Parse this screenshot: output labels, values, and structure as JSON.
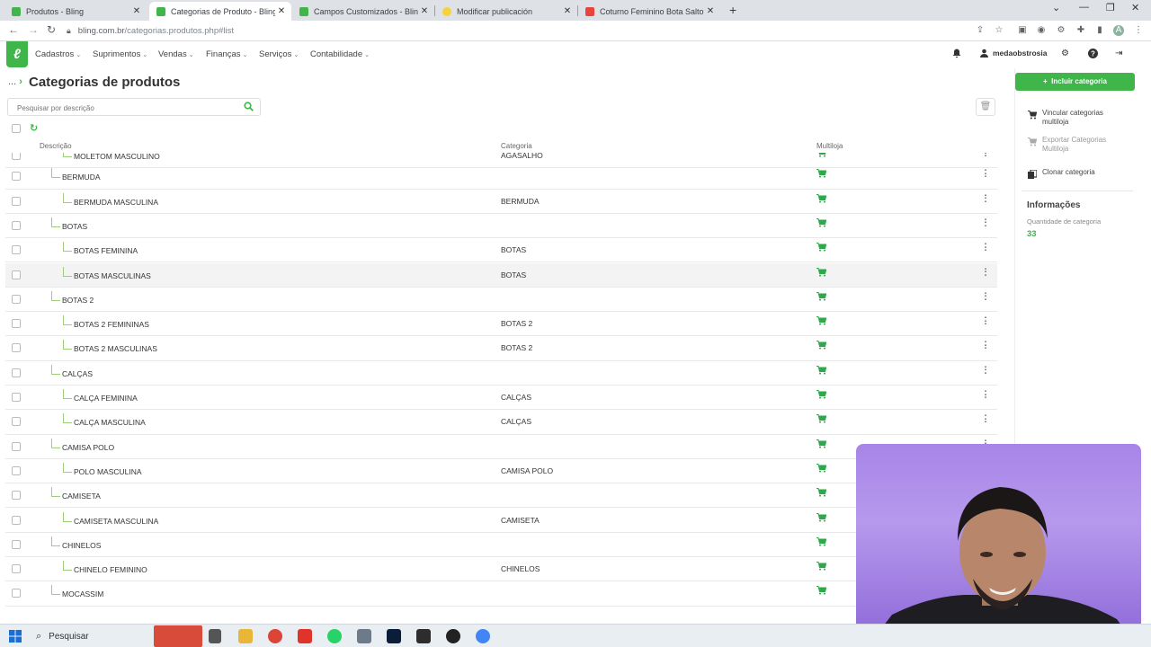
{
  "browser": {
    "tabs": [
      {
        "title": "Produtos - Bling",
        "active": false,
        "favicon": "bling-icon"
      },
      {
        "title": "Categorias de Produto - Bling",
        "active": true,
        "favicon": "bling-icon"
      },
      {
        "title": "Campos Customizados - Bling",
        "active": false,
        "favicon": "bling-icon"
      },
      {
        "title": "Modificar publicación",
        "active": false,
        "favicon": "mercadolivre-icon"
      },
      {
        "title": "Coturno Feminino Bota Salto Bai",
        "active": false,
        "favicon": "shop-icon"
      }
    ],
    "url_host": "bling.com.br",
    "url_path": "/categorias.produtos.php#list"
  },
  "app": {
    "menu": [
      {
        "label": "Cadastros"
      },
      {
        "label": "Suprimentos"
      },
      {
        "label": "Vendas"
      },
      {
        "label": "Finanças"
      },
      {
        "label": "Serviços"
      },
      {
        "label": "Contabilidade"
      }
    ],
    "user": "medaobstrosia"
  },
  "page": {
    "breadcrumb": "...",
    "title": "Categorias de produtos",
    "search_placeholder": "Pesquisar por descrição",
    "columns": {
      "descricao": "Descrição",
      "categoria": "Categoria",
      "multiloja": "Multiloja"
    }
  },
  "rows": [
    {
      "desc": "MOLETOM MASCULINO",
      "level": 2,
      "cat": "AGASALHO",
      "partial": true
    },
    {
      "desc": "BERMUDA",
      "level": 1,
      "cat": ""
    },
    {
      "desc": "BERMUDA MASCULINA",
      "level": 2,
      "cat": "BERMUDA"
    },
    {
      "desc": "BOTAS",
      "level": 1,
      "cat": ""
    },
    {
      "desc": "BOTAS FEMININA",
      "level": 2,
      "cat": "BOTAS"
    },
    {
      "desc": "BOTAS MASCULINAS",
      "level": 2,
      "cat": "BOTAS",
      "hover": true
    },
    {
      "desc": "BOTAS 2",
      "level": 1,
      "cat": ""
    },
    {
      "desc": "BOTAS 2 FEMININAS",
      "level": 2,
      "cat": "BOTAS 2"
    },
    {
      "desc": "BOTAS 2 MASCULINAS",
      "level": 2,
      "cat": "BOTAS 2"
    },
    {
      "desc": "CALÇAS",
      "level": 1,
      "cat": ""
    },
    {
      "desc": "CALÇA FEMININA",
      "level": 2,
      "cat": "CALÇAS"
    },
    {
      "desc": "CALÇA MASCULINA",
      "level": 2,
      "cat": "CALÇAS"
    },
    {
      "desc": "CAMISA POLO",
      "level": 1,
      "cat": ""
    },
    {
      "desc": "POLO MASCULINA",
      "level": 2,
      "cat": "CAMISA POLO"
    },
    {
      "desc": "CAMISETA",
      "level": 1,
      "cat": ""
    },
    {
      "desc": "CAMISETA MASCULINA",
      "level": 2,
      "cat": "CAMISETA"
    },
    {
      "desc": "CHINELOS",
      "level": 1,
      "cat": ""
    },
    {
      "desc": "CHINELO FEMININO",
      "level": 2,
      "cat": "CHINELOS"
    },
    {
      "desc": "MOCASSIM",
      "level": 1,
      "cat": ""
    }
  ],
  "sidebar": {
    "include_button": "Incluir categoria",
    "actions": [
      {
        "label": "Vincular categorias multiloja",
        "disabled": false,
        "icon": "cart-link-icon"
      },
      {
        "label": "Exportar Categorias Multiloja",
        "disabled": true,
        "icon": "cart-export-icon"
      },
      {
        "label": "Clonar categoria",
        "disabled": false,
        "icon": "clone-icon"
      }
    ],
    "info_title": "Informações",
    "info_label": "Quantidade de categoria",
    "info_value": "33"
  },
  "taskbar": {
    "search_label": "Pesquisar"
  },
  "colors": {
    "brand_green": "#3fb54a",
    "webcam_bg": "#a785e8"
  }
}
